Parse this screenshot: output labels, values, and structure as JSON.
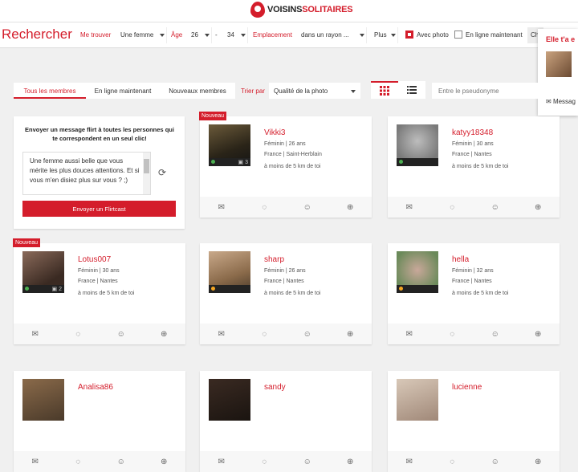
{
  "logo": {
    "part1": "VOISINS",
    "part2": "SOLITAIRES"
  },
  "searchbar": {
    "title": "Rechercher",
    "me_trouver_label": "Me trouver",
    "me_trouver_value": "Une femme",
    "age_label": "Âge",
    "age_min": "26",
    "age_sep": "-",
    "age_max": "34",
    "location_label": "Emplacement",
    "location_value": "dans un rayon ...",
    "more_label": "Plus",
    "with_photo_label": "Avec photo",
    "with_photo_checked": true,
    "online_now_label": "En ligne maintenant",
    "online_now_checked": false,
    "cut_button": "Ch"
  },
  "popup": {
    "title": "Elle t'a e",
    "message_label": "Messag"
  },
  "tabs": [
    "Tous les membres",
    "En ligne maintenant",
    "Nouveaux membres"
  ],
  "sort": {
    "label": "Trier par",
    "value": "Qualité de la photo"
  },
  "pseudo_placeholder": "Entre le pseudonyme",
  "flirtcast": {
    "heading": "Envoyer un message flirt à toutes les personnes qui te correspondent en un seul clic!",
    "message": "Une femme aussi belle que vous mérite les plus douces attentions. Et si vous m'en disiez plus sur vous ? ;)",
    "button": "Envoyer un Flirtcast"
  },
  "badge_new": "Nouveau",
  "profiles": [
    {
      "name": "Vikki3",
      "gender_age": "Féminin | 26 ans",
      "location": "France | Saint-Herblain",
      "distance": "à moins de 5 km de toi",
      "photo_count": "3",
      "is_new": true,
      "status_color": "#4caf50"
    },
    {
      "name": "katyy18348",
      "gender_age": "Féminin | 30 ans",
      "location": "France | Nantes",
      "distance": "à moins de 5 km de toi",
      "photo_count": "",
      "is_new": false,
      "status_color": "#4caf50"
    },
    {
      "name": "Lotus007",
      "gender_age": "Féminin | 30 ans",
      "location": "France | Nantes",
      "distance": "à moins de 5 km de toi",
      "photo_count": "2",
      "is_new": true,
      "status_color": "#4caf50"
    },
    {
      "name": "sharp",
      "gender_age": "Féminin | 26 ans",
      "location": "France | Nantes",
      "distance": "à moins de 5 km de toi",
      "photo_count": "",
      "is_new": false,
      "status_color": "#f5a623"
    },
    {
      "name": "hella",
      "gender_age": "Féminin | 32 ans",
      "location": "France | Nantes",
      "distance": "à moins de 5 km de toi",
      "photo_count": "",
      "is_new": false,
      "status_color": "#f5a623"
    },
    {
      "name": "Analisa86",
      "gender_age": "",
      "location": "",
      "distance": "",
      "photo_count": "",
      "is_new": false,
      "status_color": ""
    },
    {
      "name": "sandy",
      "gender_age": "",
      "location": "",
      "distance": "",
      "photo_count": "",
      "is_new": false,
      "status_color": ""
    },
    {
      "name": "lucienne",
      "gender_age": "",
      "location": "",
      "distance": "",
      "photo_count": "",
      "is_new": false,
      "status_color": ""
    }
  ],
  "colors": {
    "accent": "#d41d2b"
  }
}
